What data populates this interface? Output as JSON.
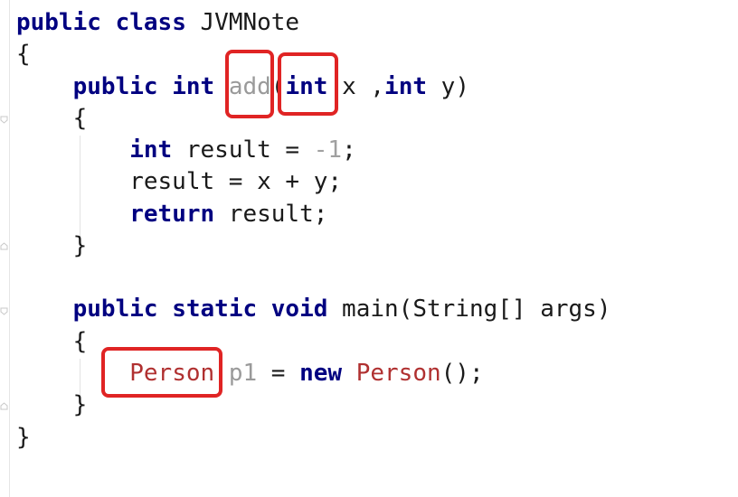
{
  "editor": {
    "lines": [
      {
        "tokens": [
          {
            "t": "public",
            "k": "kw"
          },
          {
            "t": " ",
            "k": "plain"
          },
          {
            "t": "class",
            "k": "kw"
          },
          {
            "t": " JVMNote",
            "k": "plain"
          }
        ]
      },
      {
        "tokens": [
          {
            "t": "{",
            "k": "plain"
          }
        ]
      },
      {
        "tokens": [
          {
            "t": "    ",
            "k": "plain"
          },
          {
            "t": "public",
            "k": "kw"
          },
          {
            "t": " ",
            "k": "plain"
          },
          {
            "t": "int",
            "k": "kw"
          },
          {
            "t": " ",
            "k": "plain"
          },
          {
            "t": "add",
            "k": "unused"
          },
          {
            "t": "(",
            "k": "plain"
          },
          {
            "t": "int",
            "k": "kw"
          },
          {
            "t": " x ,",
            "k": "plain"
          },
          {
            "t": "int",
            "k": "kw"
          },
          {
            "t": " y)",
            "k": "plain"
          }
        ]
      },
      {
        "tokens": [
          {
            "t": "    {",
            "k": "plain"
          }
        ]
      },
      {
        "tokens": [
          {
            "t": "        ",
            "k": "plain"
          },
          {
            "t": "int",
            "k": "kw"
          },
          {
            "t": " result = ",
            "k": "plain"
          },
          {
            "t": "-1",
            "k": "num"
          },
          {
            "t": ";",
            "k": "plain"
          }
        ]
      },
      {
        "tokens": [
          {
            "t": "        result = x + y;",
            "k": "plain"
          }
        ]
      },
      {
        "tokens": [
          {
            "t": "        ",
            "k": "plain"
          },
          {
            "t": "return",
            "k": "kw"
          },
          {
            "t": " result;",
            "k": "plain"
          }
        ]
      },
      {
        "tokens": [
          {
            "t": "    }",
            "k": "plain"
          }
        ]
      },
      {
        "tokens": [
          {
            "t": "",
            "k": "plain"
          }
        ]
      },
      {
        "tokens": [
          {
            "t": "    ",
            "k": "plain"
          },
          {
            "t": "public",
            "k": "kw"
          },
          {
            "t": " ",
            "k": "plain"
          },
          {
            "t": "static",
            "k": "kw"
          },
          {
            "t": " ",
            "k": "plain"
          },
          {
            "t": "void",
            "k": "kw"
          },
          {
            "t": " main(String[] args)",
            "k": "plain"
          }
        ]
      },
      {
        "tokens": [
          {
            "t": "    {",
            "k": "plain"
          }
        ]
      },
      {
        "tokens": [
          {
            "t": "        ",
            "k": "plain"
          },
          {
            "t": "Person",
            "k": "cls"
          },
          {
            "t": " ",
            "k": "plain"
          },
          {
            "t": "p1",
            "k": "unused"
          },
          {
            "t": " = ",
            "k": "plain"
          },
          {
            "t": "new",
            "k": "kw"
          },
          {
            "t": " ",
            "k": "plain"
          },
          {
            "t": "Person",
            "k": "cls"
          },
          {
            "t": "();",
            "k": "plain"
          }
        ]
      },
      {
        "tokens": [
          {
            "t": "    }",
            "k": "plain"
          }
        ]
      },
      {
        "tokens": [
          {
            "t": "}",
            "k": "plain"
          }
        ]
      }
    ],
    "colors": {
      "keyword": "#000080",
      "text": "#1a1a1a",
      "number": "#a0a0a0",
      "unused": "#9a9a9a",
      "class_ref": "#b03030",
      "highlight_box": "#e02424"
    },
    "highlights": [
      {
        "label_target": "add"
      },
      {
        "label_target": "(int"
      },
      {
        "label_target": "Person"
      }
    ]
  }
}
